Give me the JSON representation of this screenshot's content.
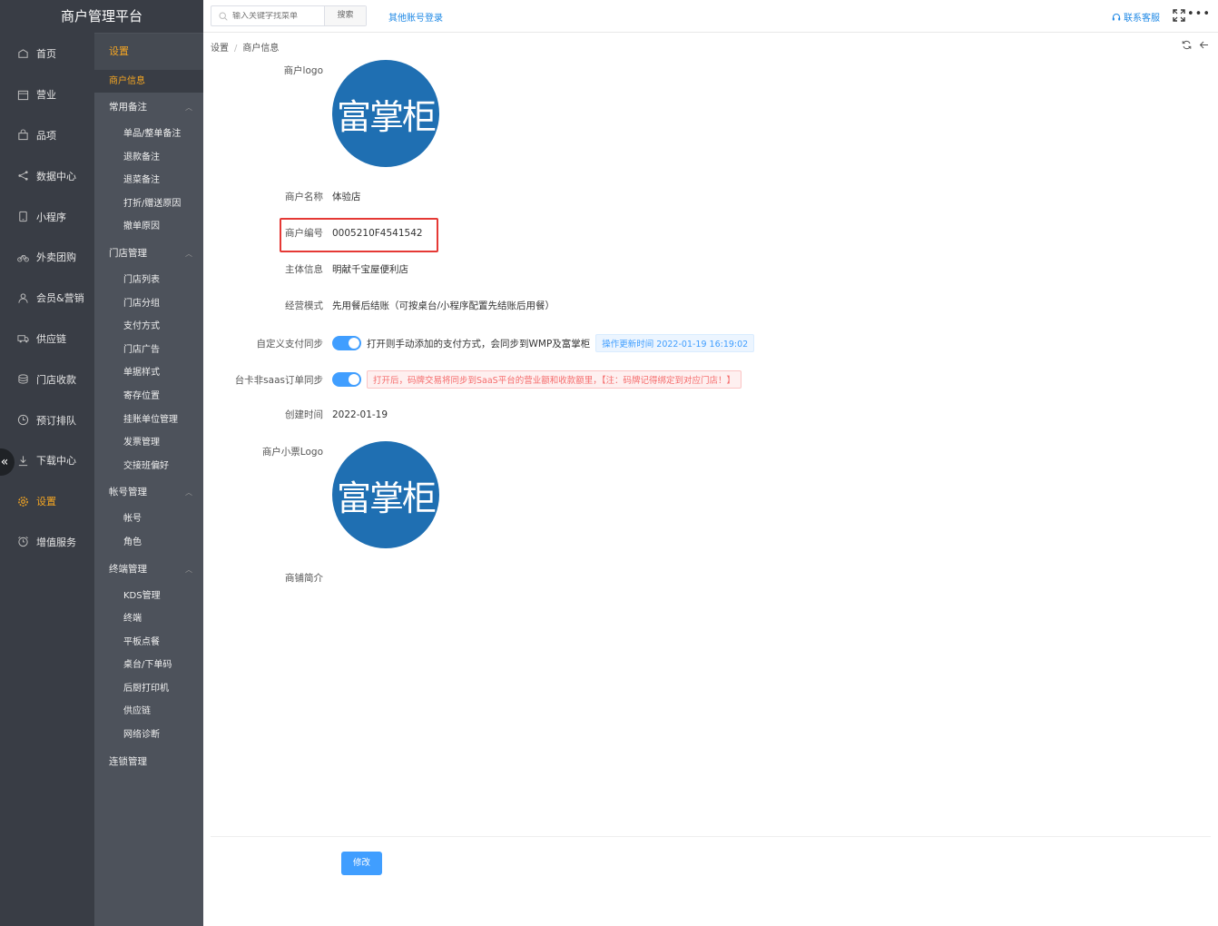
{
  "app": {
    "title": "商户管理平台"
  },
  "nav_primary": [
    {
      "label": "首页",
      "icon": "home-icon"
    },
    {
      "label": "营业",
      "icon": "calendar-icon"
    },
    {
      "label": "品项",
      "icon": "bag-icon"
    },
    {
      "label": "数据中心",
      "icon": "share-icon"
    },
    {
      "label": "小程序",
      "icon": "phone-icon"
    },
    {
      "label": "外卖团购",
      "icon": "bike-icon"
    },
    {
      "label": "会员&营销",
      "icon": "user-icon"
    },
    {
      "label": "供应链",
      "icon": "truck-icon"
    },
    {
      "label": "门店收款",
      "icon": "coins-icon"
    },
    {
      "label": "预订排队",
      "icon": "clock-icon"
    },
    {
      "label": "下载中心",
      "icon": "download-icon"
    },
    {
      "label": "设置",
      "icon": "gear-icon",
      "active": true
    },
    {
      "label": "增值服务",
      "icon": "alarm-icon"
    }
  ],
  "nav_secondary": {
    "title": "设置",
    "active_item": "商户信息",
    "groups": [
      {
        "label": "常用备注",
        "items": [
          "单品/整单备注",
          "退款备注",
          "退菜备注",
          "打折/赠送原因",
          "撤单原因"
        ]
      },
      {
        "label": "门店管理",
        "items": [
          "门店列表",
          "门店分组",
          "支付方式",
          "门店广告",
          "单据样式",
          "寄存位置",
          "挂账单位管理",
          "发票管理",
          "交接班偏好"
        ]
      },
      {
        "label": "帐号管理",
        "items": [
          "帐号",
          "角色"
        ]
      },
      {
        "label": "终端管理",
        "items": [
          "KDS管理",
          "终端",
          "平板点餐",
          "桌台/下单码",
          "后厨打印机",
          "供应链",
          "网络诊断"
        ]
      },
      {
        "label": "连锁管理",
        "items": []
      }
    ]
  },
  "topbar": {
    "search_placeholder": "输入关键字找菜单",
    "search_button": "搜索",
    "other_login": "其他账号登录",
    "contact": "联系客服"
  },
  "breadcrumb": {
    "root": "设置",
    "current": "商户信息"
  },
  "form": {
    "logo_label": "商户logo",
    "logo_text": "富掌柜",
    "name_label": "商户名称",
    "name_value": "体验店",
    "id_label": "商户编号",
    "id_value": "0005210F4541542",
    "entity_label": "主体信息",
    "entity_value": "明献千宝屋便利店",
    "mode_label": "经营模式",
    "mode_value": "先用餐后结账（可按桌台/小程序配置先结账后用餐）",
    "pay_sync_label": "自定义支付同步",
    "pay_sync_text": "打开则手动添加的支付方式，会同步到WMP及富掌柜",
    "pay_sync_tag": "操作更新时间 2022-01-19 16:19:02",
    "saas_sync_label": "台卡非saas订单同步",
    "saas_sync_tag": "打开后，码牌交易将同步到SaaS平台的营业额和收款额里，【注：码牌记得绑定到对应门店！】",
    "created_label": "创建时间",
    "created_value": "2022-01-19",
    "receipt_logo_label": "商户小票Logo",
    "intro_label": "商铺简介",
    "edit_button": "修改"
  },
  "colors": {
    "accent": "#f5a623",
    "primary": "#409eff",
    "logo_bg": "#1f6fb2",
    "highlight": "#e53935"
  }
}
